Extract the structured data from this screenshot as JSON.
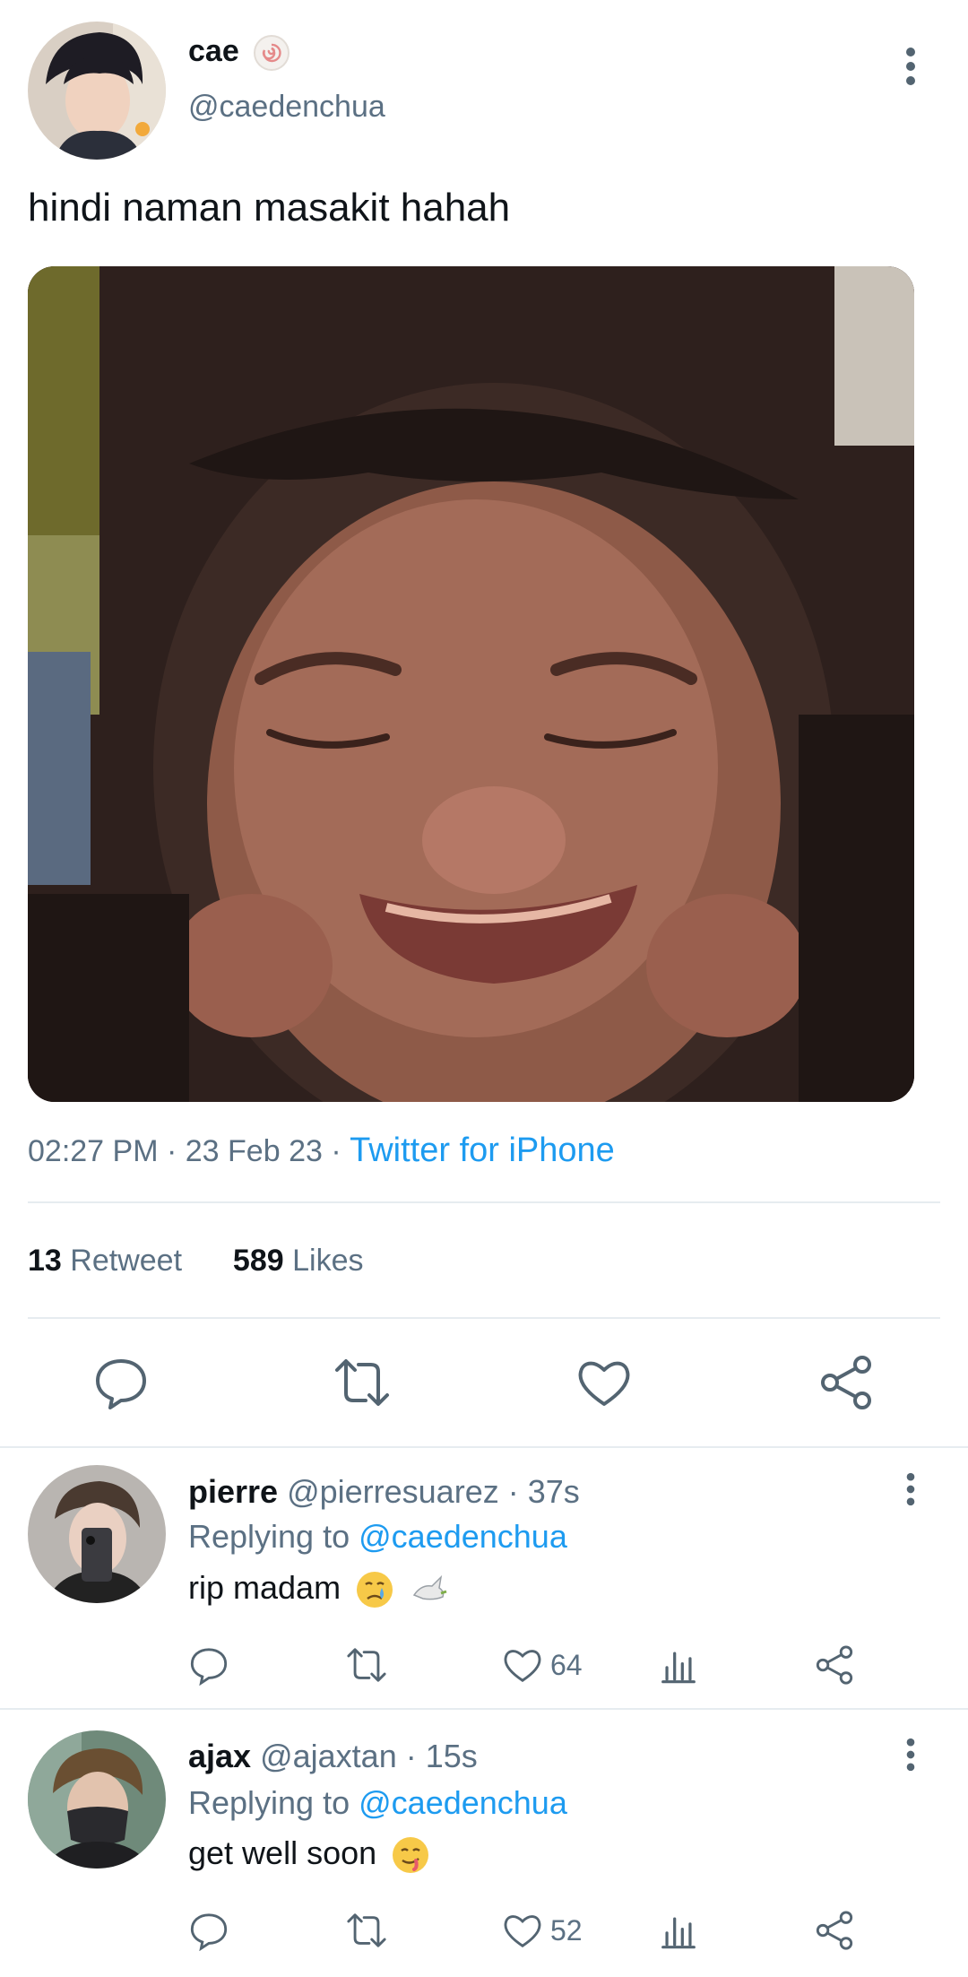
{
  "tweet": {
    "author_name": "cae",
    "author_handle": "@caedenchua",
    "text": "hindi naman masakit hahah",
    "time": "02:27 PM",
    "date": "23 Feb 23",
    "source": "Twitter for iPhone",
    "retweets": "13",
    "retweets_label": "Retweet",
    "likes": "589",
    "likes_label": "Likes",
    "actions": [
      "reply-icon",
      "retweet-icon",
      "like-icon",
      "share-icon"
    ]
  },
  "replies": [
    {
      "name": "pierre",
      "handle": "@pierresuarez",
      "time": "37s",
      "replying_label": "Replying to",
      "replying_to": "@caedenchua",
      "text": "rip madam",
      "emojis": [
        "crying-face-emoji",
        "dove-emoji"
      ],
      "likes": "64"
    },
    {
      "name": "ajax",
      "handle": "@ajaxtan",
      "time": "15s",
      "replying_label": "Replying to",
      "replying_to": "@caedenchua",
      "text": "get well soon",
      "emojis": [
        "drooling-face-emoji"
      ],
      "likes": "52"
    }
  ],
  "colors": {
    "accent": "#1d9bf0",
    "secondary_text": "#5b7083",
    "icon": "#536471",
    "divider": "#e6ecf0"
  }
}
